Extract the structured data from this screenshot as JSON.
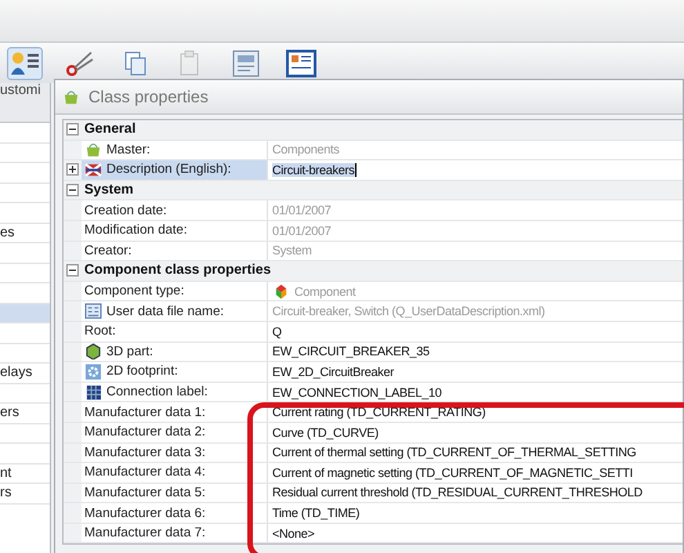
{
  "toolbar": {
    "buttons": [
      {
        "selected": true
      },
      {
        "selected": false
      },
      {
        "selected": false
      },
      {
        "selected": false
      },
      {
        "selected": false
      },
      {
        "selected": false
      }
    ],
    "label": "ustomi"
  },
  "sidebar": {
    "items": [
      {
        "selected": false
      },
      {
        "selected": false
      },
      {
        "selected": false
      },
      {
        "selected": false
      },
      {
        "selected": false
      },
      {
        "label": "es",
        "selected": false
      },
      {
        "selected": false
      },
      {
        "selected": false
      },
      {
        "selected": false
      },
      {
        "selected": true
      },
      {
        "selected": false
      },
      {
        "selected": false
      },
      {
        "label": "elays",
        "selected": false
      },
      {
        "selected": false
      },
      {
        "label": "ers",
        "selected": false
      },
      {
        "selected": false
      },
      {
        "selected": false
      },
      {
        "label": "nt",
        "selected": false
      },
      {
        "label": "rs",
        "selected": false
      }
    ]
  },
  "dialog": {
    "title": "Class properties",
    "rows": [
      {
        "kind": "group",
        "label": "General",
        "expanded": true
      },
      {
        "kind": "property",
        "label": "Master:",
        "value": "Components",
        "readonly": true,
        "selected": false
      },
      {
        "kind": "property",
        "label": "Description (English):",
        "value": "Circuit-breakers",
        "readonly": false,
        "selected": true,
        "expandable": true
      },
      {
        "kind": "group",
        "label": "System",
        "expanded": true
      },
      {
        "kind": "property",
        "label": "Creation date:",
        "value": "01/01/2007",
        "readonly": true,
        "selected": false
      },
      {
        "kind": "property",
        "label": "Modification date:",
        "value": "01/01/2007",
        "readonly": true,
        "selected": false
      },
      {
        "kind": "property",
        "label": "Creator:",
        "value": "System",
        "readonly": true,
        "selected": false
      },
      {
        "kind": "group",
        "label": "Component class properties",
        "expanded": true
      },
      {
        "kind": "property",
        "label": "Component type:",
        "value": "Component",
        "readonly": true,
        "selected": false
      },
      {
        "kind": "property",
        "label": "User data file name:",
        "value": "Circuit-breaker, Switch (Q_UserDataDescription.xml)",
        "readonly": true,
        "selected": false
      },
      {
        "kind": "property",
        "label": "Root:",
        "value": "Q",
        "readonly": false,
        "selected": false
      },
      {
        "kind": "property",
        "label": "3D part:",
        "value": "EW_CIRCUIT_BREAKER_35",
        "readonly": false,
        "selected": false
      },
      {
        "kind": "property",
        "label": "2D footprint:",
        "value": "EW_2D_CircuitBreaker",
        "readonly": false,
        "selected": false
      },
      {
        "kind": "property",
        "label": "Connection label:",
        "value": "EW_CONNECTION_LABEL_10",
        "readonly": false,
        "selected": false
      },
      {
        "kind": "property",
        "label": "Manufacturer data 1:",
        "value": "Current rating (TD_CURRENT_RATING)",
        "readonly": false,
        "selected": false
      },
      {
        "kind": "property",
        "label": "Manufacturer data 2:",
        "value": "Curve (TD_CURVE)",
        "readonly": false,
        "selected": false
      },
      {
        "kind": "property",
        "label": "Manufacturer data 3:",
        "value": "Current of thermal setting (TD_CURRENT_OF_THERMAL_SETTING",
        "readonly": false,
        "selected": false
      },
      {
        "kind": "property",
        "label": "Manufacturer data 4:",
        "value": "Current of magnetic setting (TD_CURRENT_OF_MAGNETIC_SETTI",
        "readonly": false,
        "selected": false
      },
      {
        "kind": "property",
        "label": "Manufacturer data 5:",
        "value": "Residual current threshold (TD_RESIDUAL_CURRENT_THRESHOLD",
        "readonly": false,
        "selected": false
      },
      {
        "kind": "property",
        "label": "Manufacturer data 6:",
        "value": "Time (TD_TIME)",
        "readonly": false,
        "selected": false
      },
      {
        "kind": "property",
        "label": "Manufacturer data 7:",
        "value": "<None>",
        "readonly": false,
        "selected": false
      }
    ]
  }
}
